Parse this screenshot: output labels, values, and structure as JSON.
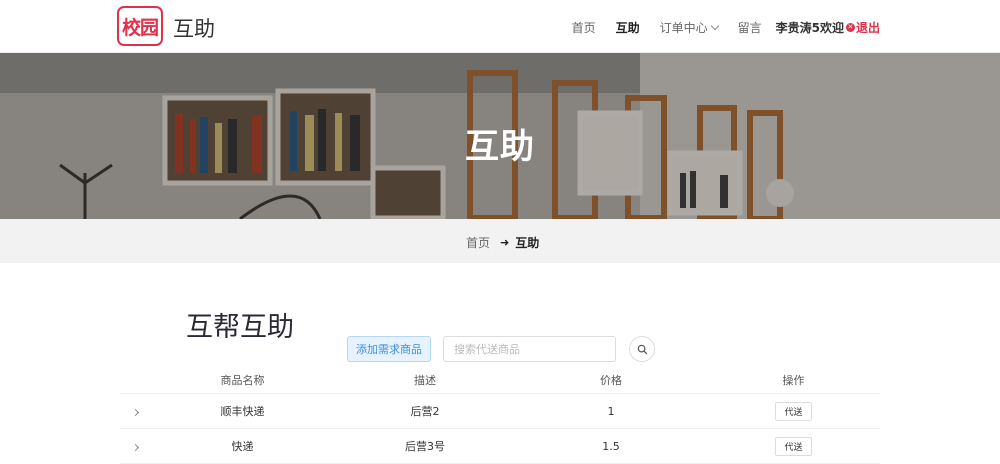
{
  "header": {
    "logo_text": "校园",
    "site_name": "互助",
    "nav": {
      "home": "首页",
      "help": "互助",
      "orders": "订单中心",
      "messages": "留言",
      "user_greeting": "李贵涛5欢迎",
      "logout": "退出"
    }
  },
  "hero": {
    "title": "互助"
  },
  "breadcrumb": {
    "home": "首页",
    "current": "互助"
  },
  "main": {
    "title": "互帮互助",
    "add_button": "添加需求商品",
    "search_placeholder": "搜索代送商品"
  },
  "table": {
    "headers": [
      "商品名称",
      "描述",
      "价格",
      "操作"
    ],
    "rows": [
      {
        "name": "顺丰快递",
        "desc": "后营2",
        "price": "1",
        "action": "代送"
      },
      {
        "name": "快递",
        "desc": "后营3号",
        "price": "1.5",
        "action": "代送"
      }
    ]
  },
  "colors": {
    "accent": "#e0314b",
    "button_blue": "#3d8ee0"
  },
  "icons": [
    "logo-badge",
    "chevron-down-icon",
    "close-circle-icon",
    "arrow-right-icon",
    "search-icon",
    "chevron-right-icon"
  ]
}
